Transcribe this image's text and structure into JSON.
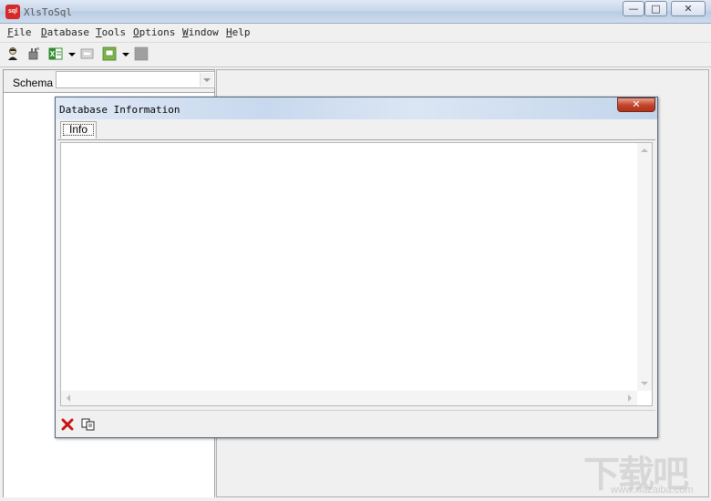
{
  "window": {
    "title": "XlsToSql",
    "app_icon_text": "sql",
    "minimize_glyph": "—",
    "maximize_glyph": "□",
    "close_glyph": "✕"
  },
  "menu": {
    "items": [
      "File",
      "Database",
      "Tools",
      "Options",
      "Window",
      "Help"
    ]
  },
  "toolbar": {
    "icons": [
      "user-icon",
      "plug-icon",
      "excel-icon",
      "dropdown-arrow",
      "dialog-icon",
      "green-window-icon",
      "dropdown-arrow",
      "stop-icon"
    ]
  },
  "left_panel": {
    "schema_label": "Schema",
    "schema_value": ""
  },
  "dialog": {
    "title": "Database Information",
    "close_glyph": "✕",
    "tabs": [
      {
        "label": "Info",
        "selected": true
      }
    ],
    "info_text": "",
    "toolbar_icons": [
      "delete-icon",
      "copy-icon"
    ]
  },
  "watermark": {
    "text": "下载吧",
    "url": "www.xiazaiba.com"
  },
  "colors": {
    "title_gradient_top": "#dfe9f5",
    "dialog_close_red": "#c2422a",
    "delete_red": "#cc1111",
    "excel_green": "#2e8b2e"
  }
}
